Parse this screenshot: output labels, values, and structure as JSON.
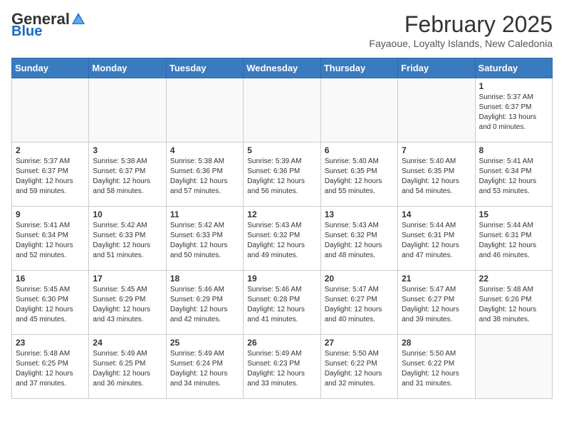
{
  "header": {
    "logo_general": "General",
    "logo_blue": "Blue",
    "month_title": "February 2025",
    "location": "Fayaoue, Loyalty Islands, New Caledonia"
  },
  "weekdays": [
    "Sunday",
    "Monday",
    "Tuesday",
    "Wednesday",
    "Thursday",
    "Friday",
    "Saturday"
  ],
  "weeks": [
    [
      {
        "day": "",
        "info": ""
      },
      {
        "day": "",
        "info": ""
      },
      {
        "day": "",
        "info": ""
      },
      {
        "day": "",
        "info": ""
      },
      {
        "day": "",
        "info": ""
      },
      {
        "day": "",
        "info": ""
      },
      {
        "day": "1",
        "info": "Sunrise: 5:37 AM\nSunset: 6:37 PM\nDaylight: 13 hours\nand 0 minutes."
      }
    ],
    [
      {
        "day": "2",
        "info": "Sunrise: 5:37 AM\nSunset: 6:37 PM\nDaylight: 12 hours\nand 59 minutes."
      },
      {
        "day": "3",
        "info": "Sunrise: 5:38 AM\nSunset: 6:37 PM\nDaylight: 12 hours\nand 58 minutes."
      },
      {
        "day": "4",
        "info": "Sunrise: 5:38 AM\nSunset: 6:36 PM\nDaylight: 12 hours\nand 57 minutes."
      },
      {
        "day": "5",
        "info": "Sunrise: 5:39 AM\nSunset: 6:36 PM\nDaylight: 12 hours\nand 56 minutes."
      },
      {
        "day": "6",
        "info": "Sunrise: 5:40 AM\nSunset: 6:35 PM\nDaylight: 12 hours\nand 55 minutes."
      },
      {
        "day": "7",
        "info": "Sunrise: 5:40 AM\nSunset: 6:35 PM\nDaylight: 12 hours\nand 54 minutes."
      },
      {
        "day": "8",
        "info": "Sunrise: 5:41 AM\nSunset: 6:34 PM\nDaylight: 12 hours\nand 53 minutes."
      }
    ],
    [
      {
        "day": "9",
        "info": "Sunrise: 5:41 AM\nSunset: 6:34 PM\nDaylight: 12 hours\nand 52 minutes."
      },
      {
        "day": "10",
        "info": "Sunrise: 5:42 AM\nSunset: 6:33 PM\nDaylight: 12 hours\nand 51 minutes."
      },
      {
        "day": "11",
        "info": "Sunrise: 5:42 AM\nSunset: 6:33 PM\nDaylight: 12 hours\nand 50 minutes."
      },
      {
        "day": "12",
        "info": "Sunrise: 5:43 AM\nSunset: 6:32 PM\nDaylight: 12 hours\nand 49 minutes."
      },
      {
        "day": "13",
        "info": "Sunrise: 5:43 AM\nSunset: 6:32 PM\nDaylight: 12 hours\nand 48 minutes."
      },
      {
        "day": "14",
        "info": "Sunrise: 5:44 AM\nSunset: 6:31 PM\nDaylight: 12 hours\nand 47 minutes."
      },
      {
        "day": "15",
        "info": "Sunrise: 5:44 AM\nSunset: 6:31 PM\nDaylight: 12 hours\nand 46 minutes."
      }
    ],
    [
      {
        "day": "16",
        "info": "Sunrise: 5:45 AM\nSunset: 6:30 PM\nDaylight: 12 hours\nand 45 minutes."
      },
      {
        "day": "17",
        "info": "Sunrise: 5:45 AM\nSunset: 6:29 PM\nDaylight: 12 hours\nand 43 minutes."
      },
      {
        "day": "18",
        "info": "Sunrise: 5:46 AM\nSunset: 6:29 PM\nDaylight: 12 hours\nand 42 minutes."
      },
      {
        "day": "19",
        "info": "Sunrise: 5:46 AM\nSunset: 6:28 PM\nDaylight: 12 hours\nand 41 minutes."
      },
      {
        "day": "20",
        "info": "Sunrise: 5:47 AM\nSunset: 6:27 PM\nDaylight: 12 hours\nand 40 minutes."
      },
      {
        "day": "21",
        "info": "Sunrise: 5:47 AM\nSunset: 6:27 PM\nDaylight: 12 hours\nand 39 minutes."
      },
      {
        "day": "22",
        "info": "Sunrise: 5:48 AM\nSunset: 6:26 PM\nDaylight: 12 hours\nand 38 minutes."
      }
    ],
    [
      {
        "day": "23",
        "info": "Sunrise: 5:48 AM\nSunset: 6:25 PM\nDaylight: 12 hours\nand 37 minutes."
      },
      {
        "day": "24",
        "info": "Sunrise: 5:49 AM\nSunset: 6:25 PM\nDaylight: 12 hours\nand 36 minutes."
      },
      {
        "day": "25",
        "info": "Sunrise: 5:49 AM\nSunset: 6:24 PM\nDaylight: 12 hours\nand 34 minutes."
      },
      {
        "day": "26",
        "info": "Sunrise: 5:49 AM\nSunset: 6:23 PM\nDaylight: 12 hours\nand 33 minutes."
      },
      {
        "day": "27",
        "info": "Sunrise: 5:50 AM\nSunset: 6:22 PM\nDaylight: 12 hours\nand 32 minutes."
      },
      {
        "day": "28",
        "info": "Sunrise: 5:50 AM\nSunset: 6:22 PM\nDaylight: 12 hours\nand 31 minutes."
      },
      {
        "day": "",
        "info": ""
      }
    ]
  ]
}
